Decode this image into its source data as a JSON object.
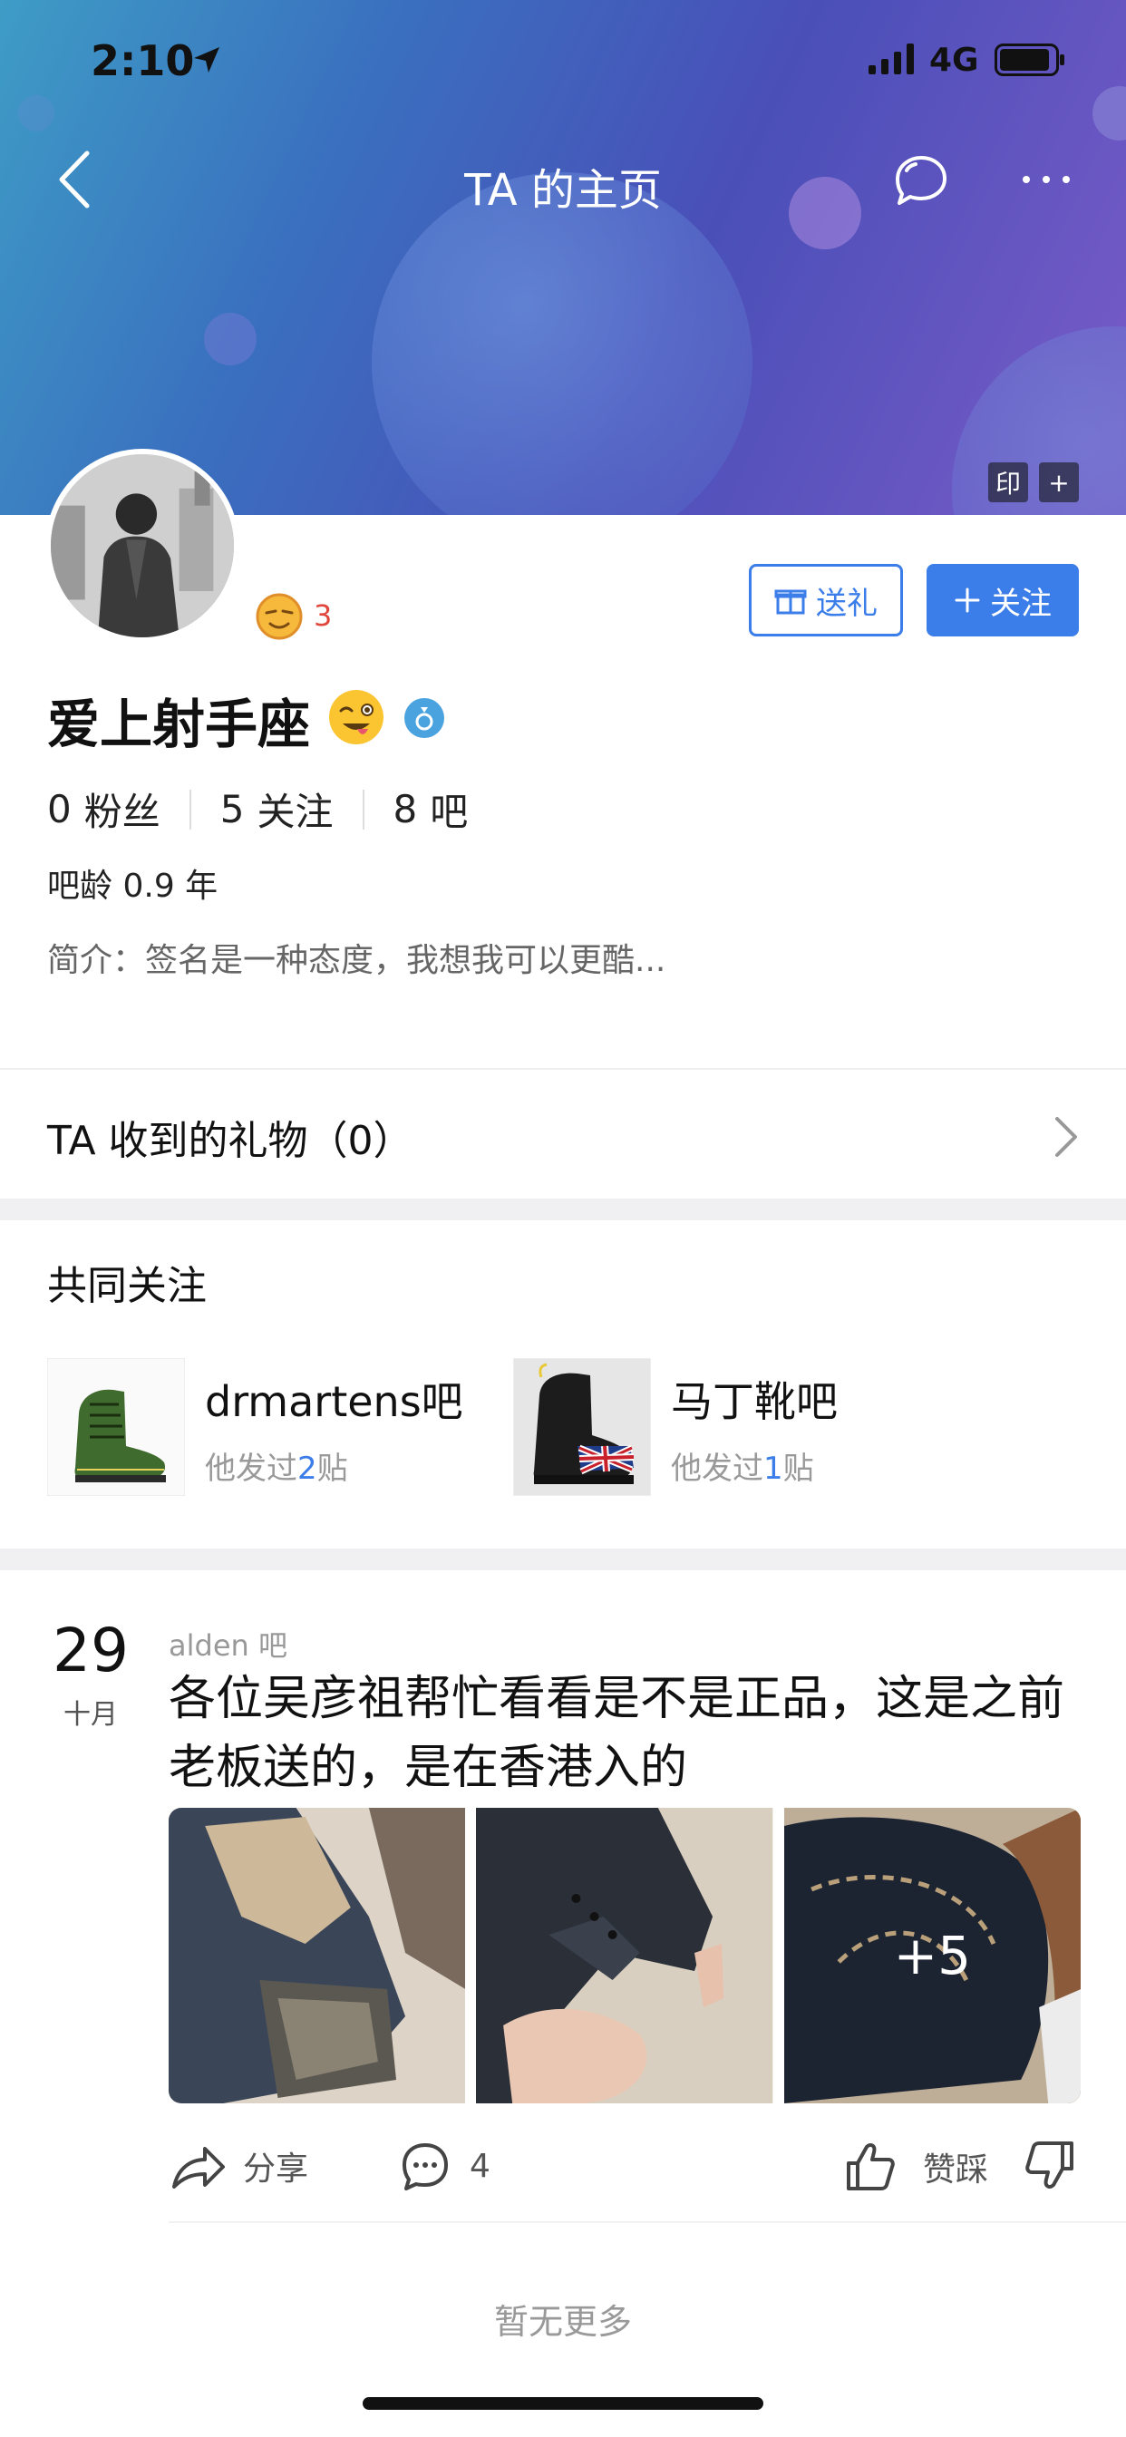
{
  "status_bar": {
    "time": "2:10",
    "network": "4G"
  },
  "nav": {
    "title": "TA 的主页"
  },
  "banner_badges": [
    "印",
    "+"
  ],
  "profile": {
    "level": "3",
    "username": "爱上射手座",
    "gift_button": "送礼",
    "follow_button": "关注",
    "stats": {
      "fans_count": "0",
      "fans_label": "粉丝",
      "following_count": "5",
      "following_label": "关注",
      "bars_count": "8",
      "bars_label": "吧"
    },
    "bar_age_label": "吧龄",
    "bar_age_value": "0.9 年",
    "bio_label": "简介：",
    "bio_text": "签名是一种态度，我想我可以更酷..."
  },
  "gifts": {
    "label": "TA 收到的礼物（0）"
  },
  "mutual": {
    "title": "共同关注",
    "items": [
      {
        "name": "drmartens吧",
        "meta_prefix": "他发过",
        "count": "2",
        "meta_suffix": "贴"
      },
      {
        "name": "马丁靴吧",
        "meta_prefix": "他发过",
        "count": "1",
        "meta_suffix": "贴"
      }
    ]
  },
  "post": {
    "day": "29",
    "month": "十月",
    "forum": "alden 吧",
    "title": "各位吴彦祖帮忙看看是不是正品，这是之前老板送的，是在香港入的",
    "more_images": "+5",
    "share_label": "分享",
    "comment_count": "4",
    "vote_label": "赞踩"
  },
  "footer": {
    "no_more": "暂无更多"
  },
  "colors": {
    "accent": "#3b7de9",
    "level": "#e0463c"
  }
}
